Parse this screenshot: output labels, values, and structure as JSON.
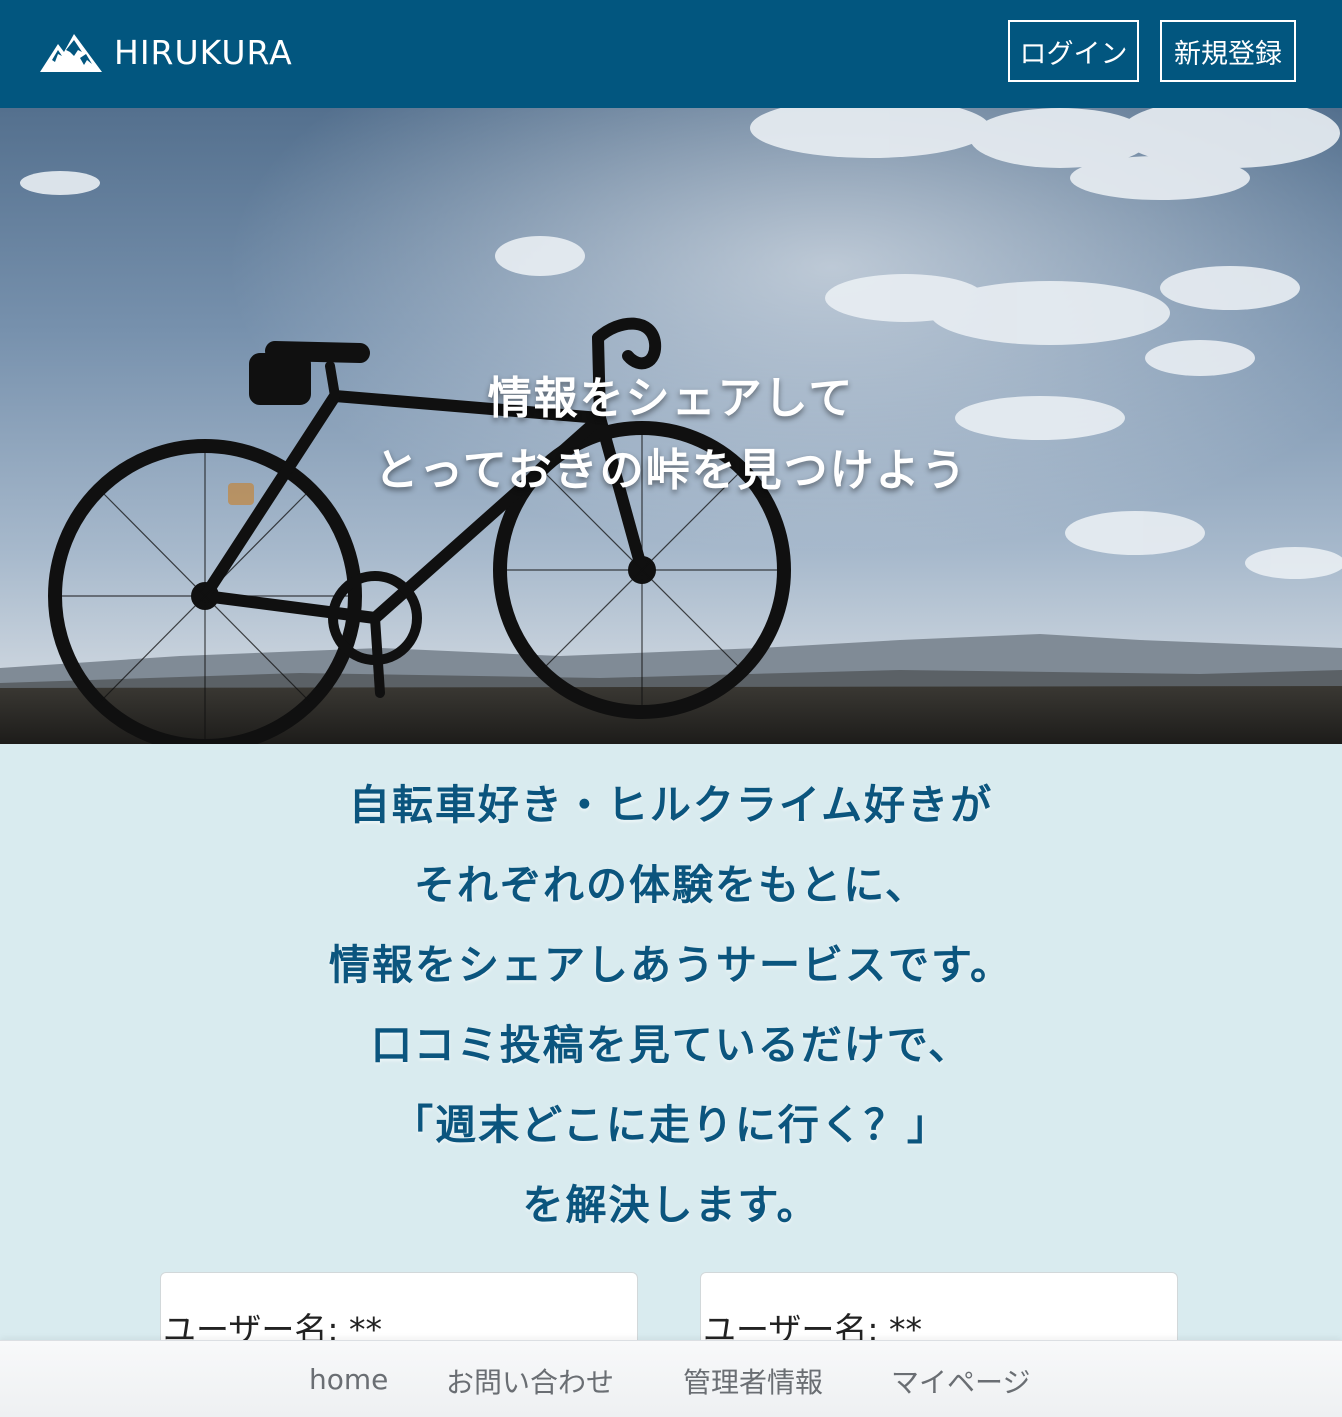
{
  "header": {
    "brand": "HIRUKURA",
    "login_label": "ログイン",
    "signup_label": "新規登録",
    "background_color": "#02567f"
  },
  "hero": {
    "line1": "情報をシェアして",
    "line2": "とっておきの峠を見つけよう"
  },
  "about": {
    "lines": [
      "自転車好き・ヒルクライム好きが",
      "それぞれの体験をもとに、",
      "情報をシェアしあうサービスです。",
      "口コミ投稿を見ているだけで、",
      "「週末どこに走りに行く？」",
      "を解決します。"
    ],
    "text_color": "#0b557e",
    "background_color": "#d9ebef"
  },
  "posts": [
    {
      "user_label": "ユーザー名: **"
    },
    {
      "user_label": "ユーザー名: **"
    }
  ],
  "bottom_nav": {
    "items": [
      "home",
      "お問い合わせ",
      "管理者情報",
      "マイページ"
    ]
  }
}
